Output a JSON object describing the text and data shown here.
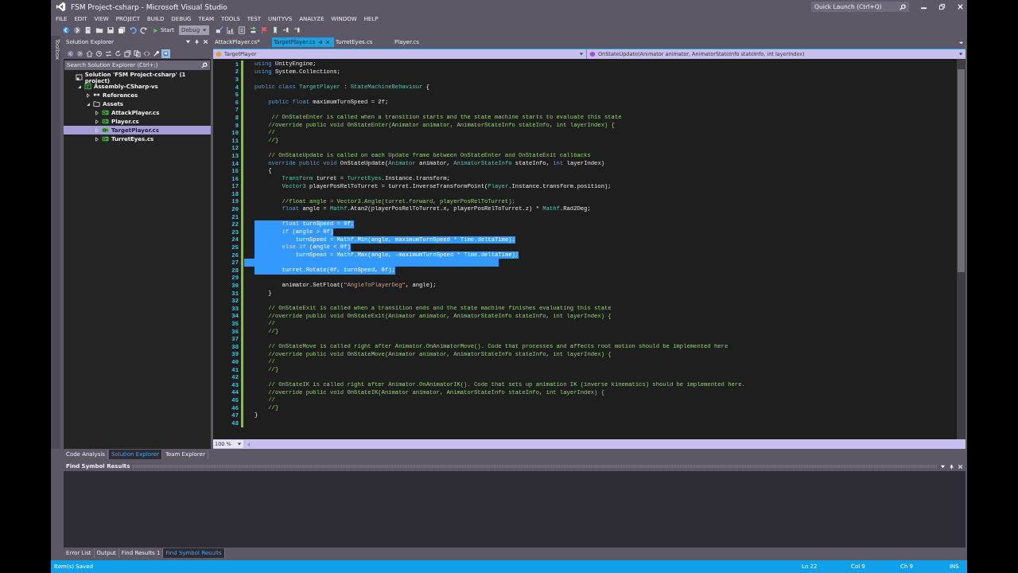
{
  "window": {
    "title": "FSM Project-csharp - Microsoft Visual Studio",
    "quick_launch": {
      "placeholder": "Quick Launch (Ctrl+Q)"
    }
  },
  "menu": [
    "FILE",
    "EDIT",
    "VIEW",
    "PROJECT",
    "BUILD",
    "DEBUG",
    "TEAM",
    "TOOLS",
    "TEST",
    "UNITYVS",
    "ANALYZE",
    "WINDOW",
    "HELP"
  ],
  "toolbar": {
    "start": "Start",
    "configuration": "Debug"
  },
  "toolbox_tab": "Toolbox",
  "solution_explorer": {
    "title": "Solution Explorer",
    "search": {
      "placeholder": "Search Solution Explorer (Ctrl+;)"
    },
    "items": [
      {
        "label": "Solution 'FSM Project-csharp' (1 project)",
        "kind": "solution",
        "selected": false,
        "children": [
          {
            "label": "Assembly-CSharp-vs",
            "kind": "project",
            "expanded": true,
            "selected": false,
            "children": [
              {
                "label": "References",
                "kind": "references",
                "expanded": false,
                "selected": false
              },
              {
                "label": "Assets",
                "kind": "folder",
                "expanded": true,
                "selected": false,
                "children": [
                  {
                    "label": "AttackPlayer.cs",
                    "kind": "file",
                    "expanded": false,
                    "selected": false
                  },
                  {
                    "label": "Player.cs",
                    "kind": "file",
                    "expanded": false,
                    "selected": false
                  },
                  {
                    "label": "TargetPlayer.cs",
                    "kind": "file",
                    "expanded": false,
                    "selected": true
                  },
                  {
                    "label": "TurretEyes.cs",
                    "kind": "file",
                    "expanded": false,
                    "selected": false
                  }
                ]
              }
            ]
          }
        ]
      }
    ]
  },
  "document_tabs": [
    {
      "label": "AttackPlayer.cs*",
      "selected": false
    },
    {
      "label": "TargetPlayer.cs",
      "selected": true
    },
    {
      "label": "TurretEyes.cs",
      "selected": false
    },
    {
      "label": "Player.cs",
      "selected": false
    }
  ],
  "navigation_bar": {
    "class": "TargetPlayer",
    "member": "OnStateUpdate(Animator animator, AnimatorStateInfo stateInfo, int layerIndex)"
  },
  "code_lines": [
    {
      "number": "1",
      "selected": false,
      "segments": [
        {
          "text": "using",
          "kind": "keyword"
        },
        {
          "text": " UnityEngine;",
          "kind": "plain"
        }
      ]
    },
    {
      "number": "2",
      "selected": false,
      "segments": [
        {
          "text": "using",
          "kind": "keyword"
        },
        {
          "text": " System.Collections;",
          "kind": "plain"
        }
      ]
    },
    {
      "number": "3",
      "selected": false
    },
    {
      "number": "4",
      "selected": false,
      "segments": [
        {
          "text": "public class",
          "kind": "keyword"
        },
        {
          "text": " TargetPlayer",
          "kind": "type"
        },
        {
          "text": " : ",
          "kind": "plain"
        },
        {
          "text": "StateMachineBehaviour",
          "kind": "type"
        },
        {
          "text": " {",
          "kind": "plain"
        }
      ]
    },
    {
      "number": "5",
      "selected": false
    },
    {
      "number": "6",
      "selected": false,
      "segments": [
        {
          "text": "    public float",
          "kind": "keyword"
        },
        {
          "text": " maximumTurnSpeed = 2f;",
          "kind": "plain"
        }
      ]
    },
    {
      "number": "7",
      "selected": false
    },
    {
      "number": "8",
      "selected": false,
      "segments": [
        {
          "text": "     // OnStateEnter is called when a transition starts and the state machine starts to evaluate this state",
          "kind": "comment"
        }
      ]
    },
    {
      "number": "9",
      "selected": false,
      "segments": [
        {
          "text": "    //override public void OnStateEnter(Animator animator, AnimatorStateInfo stateInfo, int layerIndex) {",
          "kind": "comment"
        }
      ]
    },
    {
      "number": "10",
      "selected": false,
      "segments": [
        {
          "text": "    //",
          "kind": "comment"
        }
      ]
    },
    {
      "number": "11",
      "selected": false,
      "segments": [
        {
          "text": "    //}",
          "kind": "comment"
        }
      ]
    },
    {
      "number": "12",
      "selected": false
    },
    {
      "number": "13",
      "selected": false,
      "segments": [
        {
          "text": "    // OnStateUpdate is called on each Update frame between OnStateEnter and OnStateExit callbacks",
          "kind": "comment"
        }
      ]
    },
    {
      "number": "14",
      "selected": false,
      "segments": [
        {
          "text": "    override public void",
          "kind": "keyword"
        },
        {
          "text": " OnStateUpdate(",
          "kind": "plain"
        },
        {
          "text": "Animator",
          "kind": "type"
        },
        {
          "text": " animator, ",
          "kind": "plain"
        },
        {
          "text": "AnimatorStateInfo",
          "kind": "type"
        },
        {
          "text": " stateInfo, ",
          "kind": "plain"
        },
        {
          "text": "int",
          "kind": "keyword"
        },
        {
          "text": " layerIndex)",
          "kind": "plain"
        }
      ]
    },
    {
      "number": "15",
      "selected": false,
      "segments": [
        {
          "text": "    {",
          "kind": "plain"
        }
      ]
    },
    {
      "number": "16",
      "selected": false,
      "segments": [
        {
          "text": "        Transform",
          "kind": "type"
        },
        {
          "text": " turret = ",
          "kind": "plain"
        },
        {
          "text": "TurretEyes",
          "kind": "type"
        },
        {
          "text": ".Instance.transform;",
          "kind": "plain"
        }
      ]
    },
    {
      "number": "17",
      "selected": false,
      "segments": [
        {
          "text": "        Vector3",
          "kind": "type"
        },
        {
          "text": " playerPosRelToTurret = turret.InverseTransformPoint(",
          "kind": "plain"
        },
        {
          "text": "Player",
          "kind": "type"
        },
        {
          "text": ".Instance.transform.position);",
          "kind": "plain"
        }
      ]
    },
    {
      "number": "18",
      "selected": false
    },
    {
      "number": "19",
      "selected": false,
      "segments": [
        {
          "text": "        //float angle = Vector3.Angle(turret.forward, playerPosRelToTurret);",
          "kind": "comment"
        }
      ]
    },
    {
      "number": "20",
      "selected": false,
      "segments": [
        {
          "text": "        float",
          "kind": "keyword"
        },
        {
          "text": " angle = ",
          "kind": "plain"
        },
        {
          "text": "Mathf",
          "kind": "type"
        },
        {
          "text": ".Atan2(playerPosRelToTurret.x, playerPosRelToTurret.z) * ",
          "kind": "plain"
        },
        {
          "text": "Mathf",
          "kind": "type"
        },
        {
          "text": ".Rad2Deg;",
          "kind": "plain"
        }
      ]
    },
    {
      "number": "21",
      "selected": false
    },
    {
      "number": "22",
      "selected": true,
      "segments": [
        {
          "text": "        float",
          "kind": "keyword"
        },
        {
          "text": " turnSpeed = 0f;",
          "kind": "plain"
        }
      ]
    },
    {
      "number": "23",
      "selected": true,
      "segments": [
        {
          "text": "        if",
          "kind": "keyword"
        },
        {
          "text": " (angle > 0f)",
          "kind": "plain"
        }
      ]
    },
    {
      "number": "24",
      "selected": true,
      "segments": [
        {
          "text": "            turnSpeed = ",
          "kind": "plain"
        },
        {
          "text": "Mathf",
          "kind": "type"
        },
        {
          "text": ".Min(angle, maximumTurnSpeed * ",
          "kind": "plain"
        },
        {
          "text": "Time",
          "kind": "type"
        },
        {
          "text": ".deltaTime);",
          "kind": "plain"
        }
      ]
    },
    {
      "number": "25",
      "selected": true,
      "segments": [
        {
          "text": "        else if",
          "kind": "keyword"
        },
        {
          "text": " (angle < 0f)",
          "kind": "plain"
        }
      ]
    },
    {
      "number": "26",
      "selected": true,
      "segments": [
        {
          "text": "            turnSpeed = ",
          "kind": "plain"
        },
        {
          "text": "Mathf",
          "kind": "type"
        },
        {
          "text": ".Max(angle, -maximumTurnSpeed * ",
          "kind": "plain"
        },
        {
          "text": "Time",
          "kind": "type"
        },
        {
          "text": ".deltaTime);",
          "kind": "plain"
        }
      ]
    },
    {
      "number": "27",
      "selected": true
    },
    {
      "number": "28",
      "selected": true,
      "segments": [
        {
          "text": "        turret.Rotate(0f, turnSpeed, 0f);",
          "kind": "plain"
        }
      ]
    },
    {
      "number": "29",
      "selected": false
    },
    {
      "number": "30",
      "selected": false,
      "segments": [
        {
          "text": "        animator.SetFloat(",
          "kind": "plain"
        },
        {
          "text": "\"AngleToPlayerDeg\"",
          "kind": "string"
        },
        {
          "text": ", angle);",
          "kind": "plain"
        }
      ]
    },
    {
      "number": "31",
      "selected": false,
      "segments": [
        {
          "text": "    }",
          "kind": "plain"
        }
      ]
    },
    {
      "number": "32",
      "selected": false
    },
    {
      "number": "33",
      "selected": false,
      "segments": [
        {
          "text": "    // OnStateExit is called when a transition ends and the state machine finishes evaluating this state",
          "kind": "comment"
        }
      ]
    },
    {
      "number": "34",
      "selected": false,
      "segments": [
        {
          "text": "    //override public void OnStateExit(Animator animator, AnimatorStateInfo stateInfo, int layerIndex) {",
          "kind": "comment"
        }
      ]
    },
    {
      "number": "35",
      "selected": false,
      "segments": [
        {
          "text": "    //",
          "kind": "comment"
        }
      ]
    },
    {
      "number": "36",
      "selected": false,
      "segments": [
        {
          "text": "    //}",
          "kind": "comment"
        }
      ]
    },
    {
      "number": "37",
      "selected": false
    },
    {
      "number": "38",
      "selected": false,
      "segments": [
        {
          "text": "    // OnStateMove is called right after Animator.OnAnimatorMove(). Code that processes and affects root motion should be implemented here",
          "kind": "comment"
        }
      ]
    },
    {
      "number": "39",
      "selected": false,
      "segments": [
        {
          "text": "    //override public void OnStateMove(Animator animator, AnimatorStateInfo stateInfo, int layerIndex) {",
          "kind": "comment"
        }
      ]
    },
    {
      "number": "40",
      "selected": false,
      "segments": [
        {
          "text": "    //",
          "kind": "comment"
        }
      ]
    },
    {
      "number": "41",
      "selected": false,
      "segments": [
        {
          "text": "    //}",
          "kind": "comment"
        }
      ]
    },
    {
      "number": "42",
      "selected": false
    },
    {
      "number": "43",
      "selected": false,
      "segments": [
        {
          "text": "    // OnStateIK is called right after Animator.OnAnimatorIK(). Code that sets up animation IK (inverse kinematics) should be implemented here.",
          "kind": "comment"
        }
      ]
    },
    {
      "number": "44",
      "selected": false,
      "segments": [
        {
          "text": "    //override public void OnStateIK(Animator animator, AnimatorStateInfo stateInfo, int layerIndex) {",
          "kind": "comment"
        }
      ]
    },
    {
      "number": "45",
      "selected": false,
      "segments": [
        {
          "text": "    //",
          "kind": "comment"
        }
      ]
    },
    {
      "number": "46",
      "selected": false,
      "segments": [
        {
          "text": "    //}",
          "kind": "comment"
        }
      ]
    },
    {
      "number": "47",
      "selected": false,
      "segments": [
        {
          "text": "}",
          "kind": "plain"
        }
      ]
    },
    {
      "number": "48",
      "selected": false
    }
  ],
  "zoom": "100 %",
  "left_panel_tabs": [
    {
      "label": "Code Analysis",
      "selected": false
    },
    {
      "label": "Solution Explorer",
      "selected": true
    },
    {
      "label": "Team Explorer",
      "selected": false
    }
  ],
  "find_symbol_results": {
    "title": "Find Symbol Results"
  },
  "bottom_tabs": [
    {
      "label": "Error List",
      "selected": false
    },
    {
      "label": "Output",
      "selected": false
    },
    {
      "label": "Find Results 1",
      "selected": false
    },
    {
      "label": "Find Symbol Results",
      "selected": true
    }
  ],
  "status_bar": {
    "message": "Item(s) Saved",
    "line": "Ln 22",
    "column": "Col 9",
    "character": "Ch 9",
    "mode": "INS"
  }
}
